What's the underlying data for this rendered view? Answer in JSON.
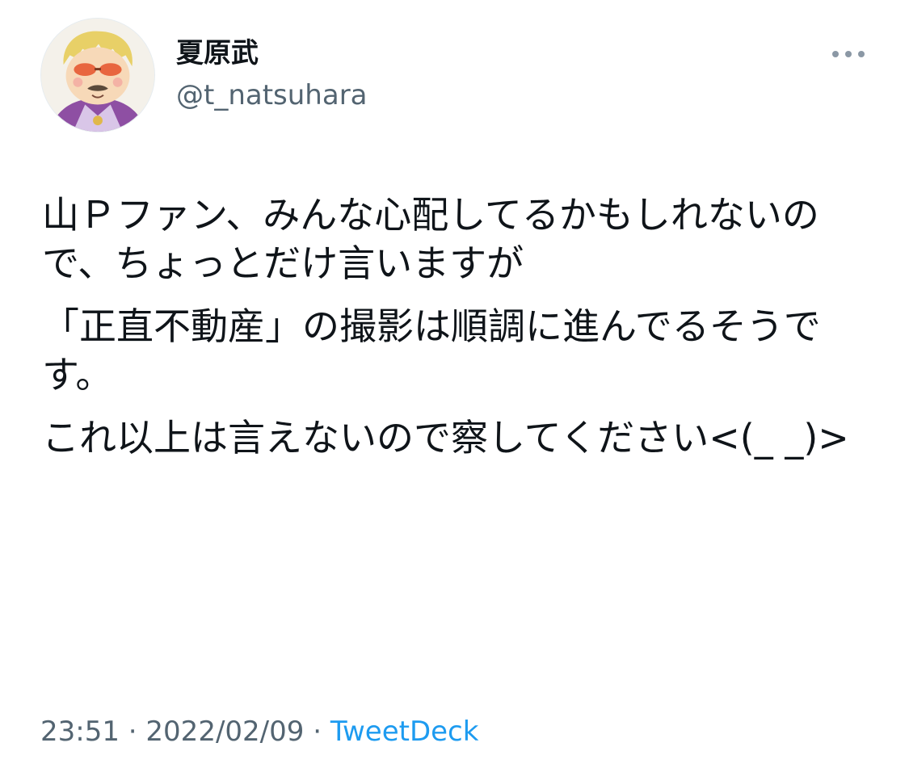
{
  "author": {
    "display_name": "夏原武",
    "handle": "@t_natsuhara",
    "avatar_icon": "cartoon-avatar-icon"
  },
  "tweet": {
    "paragraphs": [
      "山Ｐファン、みんな心配してるかもしれないので、ちょっとだけ言いますが",
      "「正直不動産」の撮影は順調に進んでるそうです。",
      "これ以上は言えないので察してください<(_ _)>"
    ]
  },
  "meta": {
    "time": "23:51",
    "separator": " · ",
    "date": "2022/02/09",
    "source": "TweetDeck"
  },
  "icons": {
    "more": "more-options-icon"
  },
  "colors": {
    "text": "#0f1419",
    "secondary": "#536471",
    "link": "#1d9bf0"
  }
}
